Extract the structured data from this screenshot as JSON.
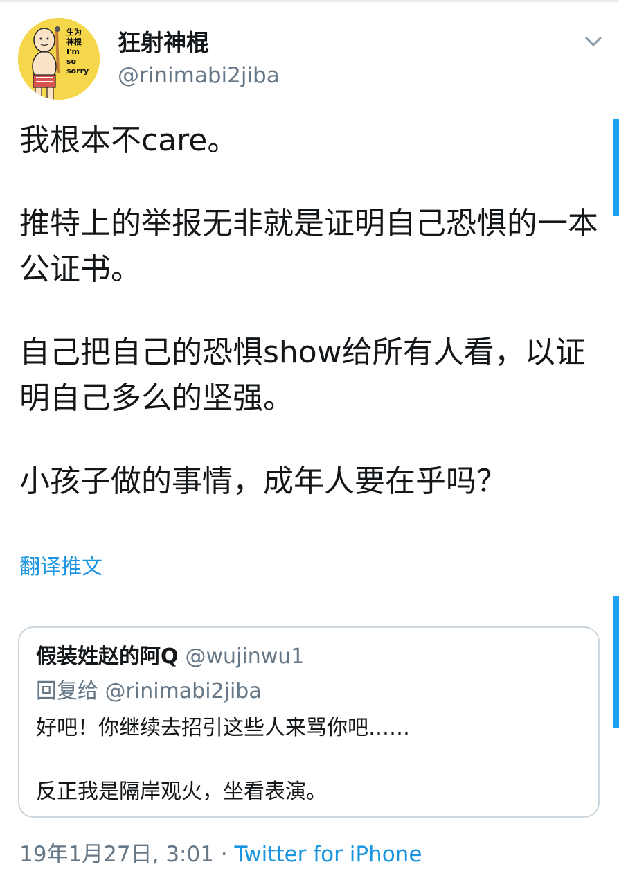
{
  "tweet": {
    "display_name": "狂射神棍",
    "handle": "@rinimabi2jiba",
    "avatar_caption": [
      "生为",
      "神棍",
      "I'm",
      "so",
      "sorry"
    ],
    "body": [
      "我根本不care。",
      "推特上的举报无非就是证明自己恐惧的一本公证书。",
      "自己把自己的恐惧show给所有人看，以证明自己多么的坚强。",
      "小孩子做的事情，成年人要在乎吗？"
    ],
    "translate_label": "翻译推文",
    "timestamp": "19年1月27日, 3:01",
    "separator": "·",
    "source": "Twitter for iPhone"
  },
  "quoted": {
    "display_name": "假装姓赵的阿Q",
    "handle": "@wujinwu1",
    "reply_to": "回复给 @rinimabi2jiba",
    "body": [
      "好吧！你继续去招引这些人来骂你吧……",
      "反正我是隔岸观火，坐看表演。"
    ]
  },
  "colors": {
    "link_blue": "#1b95e0",
    "secondary_gray": "#657786",
    "border": "#ccd6dd",
    "avatar_bg": "#f6d64a"
  },
  "icons": {
    "more": "chevron-down-icon"
  }
}
